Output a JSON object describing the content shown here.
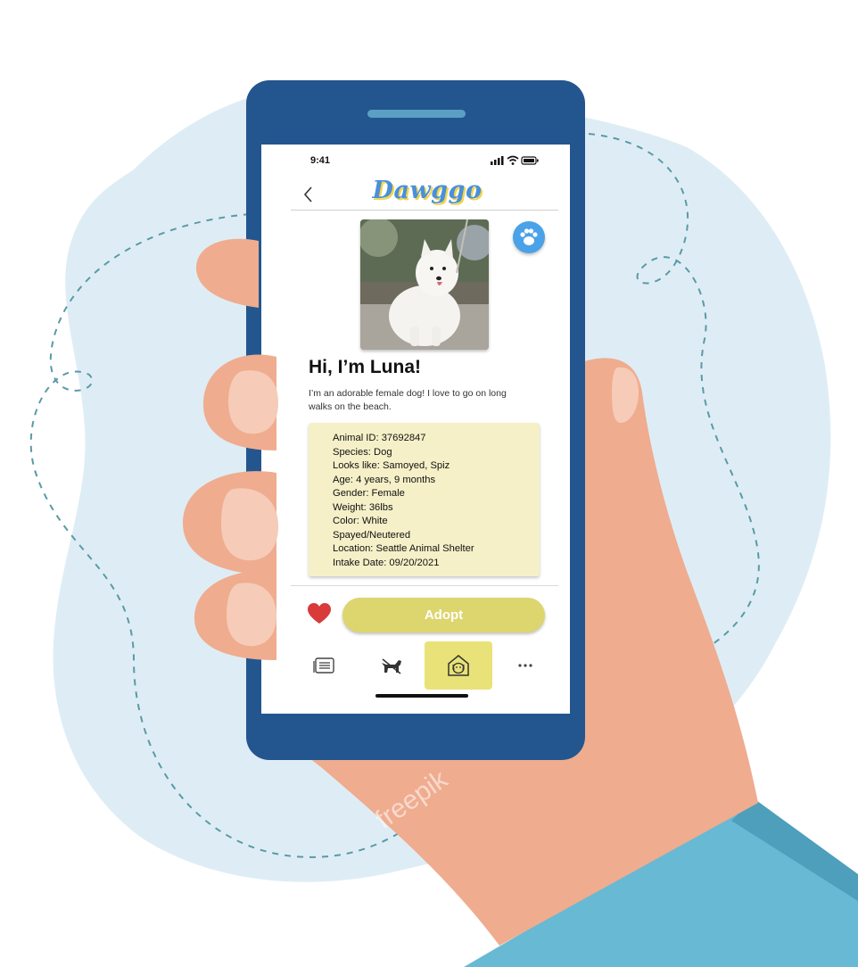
{
  "status_bar": {
    "time": "9:41"
  },
  "header": {
    "app_name": "Dawggo"
  },
  "pet": {
    "title": "Hi, I’m Luna!",
    "bio": "I’m an adorable female dog! I love to go on long walks on the beach.",
    "details": [
      "Animal ID: 37692847",
      "Species: Dog",
      "Looks like:  Samoyed, Spiz",
      "Age: 4 years, 9 months",
      "Gender: Female",
      "Weight: 36lbs",
      "Color: White",
      "Spayed/Neutered",
      "Location: Seattle Animal Shelter",
      "Intake Date: 09/20/2021"
    ]
  },
  "actions": {
    "adopt_label": "Adopt",
    "favorite_icon": "heart-icon"
  },
  "tabbar": {
    "tabs": [
      {
        "icon": "list-icon",
        "active": false
      },
      {
        "icon": "dog-icon",
        "active": false
      },
      {
        "icon": "shelter-icon",
        "active": true
      },
      {
        "icon": "more-icon",
        "active": false
      }
    ]
  },
  "colors": {
    "phone_body": "#23568f",
    "accent_blue": "#4aa2e8",
    "adopt_button": "#ddd56e",
    "info_card": "#f6f0c8",
    "heart": "#d93a3a",
    "active_tab": "#e9e278"
  },
  "watermark": "freepik"
}
